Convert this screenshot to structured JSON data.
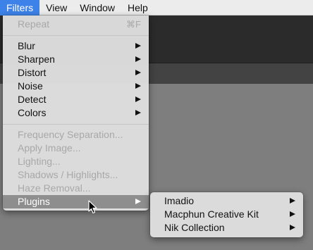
{
  "menubar": {
    "items": [
      "Filters",
      "View",
      "Window",
      "Help"
    ]
  },
  "filters_menu": {
    "repeat": {
      "label": "Repeat",
      "shortcut": "⌘F"
    },
    "group1": [
      "Blur",
      "Sharpen",
      "Distort",
      "Noise",
      "Detect",
      "Colors"
    ],
    "group2": [
      "Frequency Separation...",
      "Apply Image...",
      "Lighting...",
      "Shadows / Highlights...",
      "Haze Removal..."
    ],
    "plugins": "Plugins"
  },
  "plugins_submenu": {
    "items": [
      "Imadio",
      "Macphun Creative Kit",
      "Nik Collection"
    ]
  },
  "colors": {
    "menubar_highlight": "#3d82e8",
    "menu_highlight": "#8e8e8e",
    "disabled_text": "#a8a8a8"
  },
  "icons": [
    "submenu-arrow-icon",
    "mouse-pointer-icon"
  ]
}
